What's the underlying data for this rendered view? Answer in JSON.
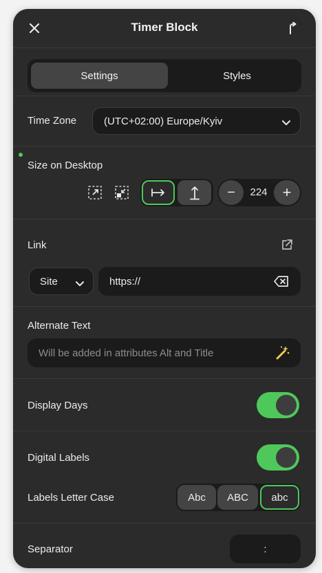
{
  "header": {
    "title": "Timer Block",
    "close_icon": "close-icon",
    "pin_icon": "pin-icon"
  },
  "tabs": [
    {
      "label": "Settings",
      "active": true
    },
    {
      "label": "Styles",
      "active": false
    }
  ],
  "timezone": {
    "label": "Time Zone",
    "value": "(UTC+02:00) Europe/Kyiv"
  },
  "size": {
    "label": "Size on Desktop",
    "value": "224",
    "minus": "−",
    "plus": "+"
  },
  "link": {
    "label": "Link",
    "type_value": "Site",
    "url_value": "https://"
  },
  "alt_text": {
    "label": "Alternate Text",
    "placeholder": "Will be added in attributes Alt and Title"
  },
  "display_days": {
    "label": "Display Days",
    "enabled": true
  },
  "digital_labels": {
    "label": "Digital Labels",
    "enabled": true
  },
  "letter_case": {
    "label": "Labels Letter Case",
    "options": [
      "Abc",
      "ABC",
      "abc"
    ],
    "selected": "abc"
  },
  "separator": {
    "label": "Separator",
    "value": ":"
  },
  "colors": {
    "accent": "#4fc85b",
    "panel": "#2b2b2b",
    "field": "#1b1b1b"
  }
}
